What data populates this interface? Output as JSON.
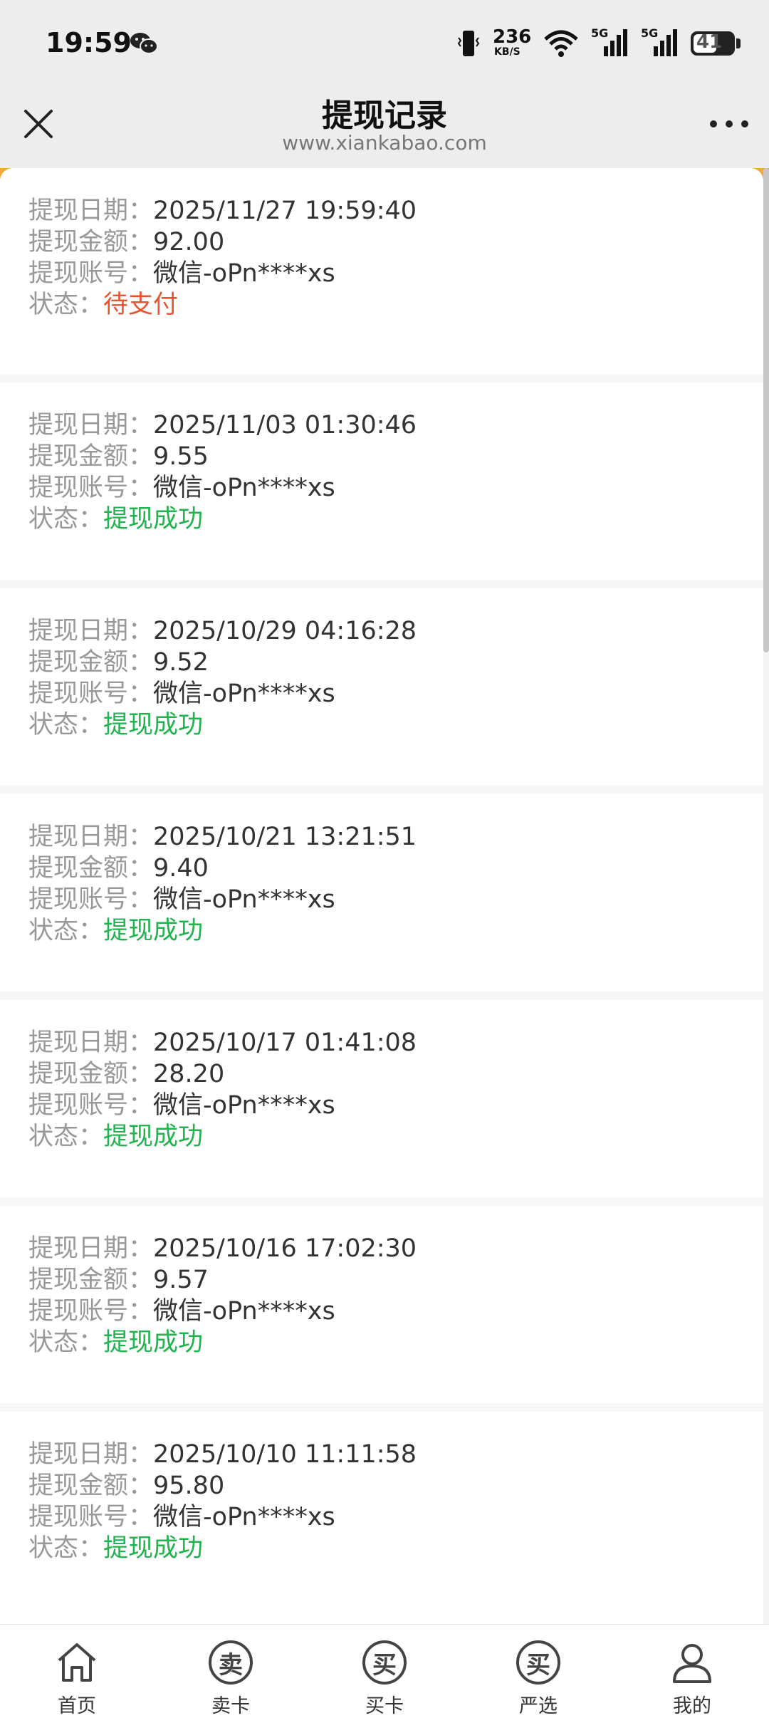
{
  "status_bar": {
    "time": "19:59",
    "network_speed": "236",
    "network_speed_unit": "KB/S",
    "signal1_label": "5G",
    "signal2_label": "5G",
    "battery": "41",
    "icons": [
      "wechat-icon",
      "vibrate-icon",
      "wifi-icon",
      "signal-icon",
      "battery-icon"
    ]
  },
  "header": {
    "title": "提现记录",
    "url": "www.xiankabao.com"
  },
  "labels": {
    "date": "提现日期：",
    "amount": "提现金额：",
    "account": "提现账号：",
    "status": "状态："
  },
  "records": [
    {
      "date": "2025/11/27 19:59:40",
      "amount": "92.00",
      "account": "微信-oPn****xs",
      "status": "待支付",
      "status_type": "pending"
    },
    {
      "date": "2025/11/03 01:30:46",
      "amount": "9.55",
      "account": "微信-oPn****xs",
      "status": "提现成功",
      "status_type": "success"
    },
    {
      "date": "2025/10/29 04:16:28",
      "amount": "9.52",
      "account": "微信-oPn****xs",
      "status": "提现成功",
      "status_type": "success"
    },
    {
      "date": "2025/10/21 13:21:51",
      "amount": "9.40",
      "account": "微信-oPn****xs",
      "status": "提现成功",
      "status_type": "success"
    },
    {
      "date": "2025/10/17 01:41:08",
      "amount": "28.20",
      "account": "微信-oPn****xs",
      "status": "提现成功",
      "status_type": "success"
    },
    {
      "date": "2025/10/16 17:02:30",
      "amount": "9.57",
      "account": "微信-oPn****xs",
      "status": "提现成功",
      "status_type": "success"
    },
    {
      "date": "2025/10/10 11:11:58",
      "amount": "95.80",
      "account": "微信-oPn****xs",
      "status": "提现成功",
      "status_type": "success"
    }
  ],
  "colors": {
    "pending": "#e8542e",
    "success": "#21b34e",
    "accent_orange": "#f4a83a"
  },
  "bottom_nav": [
    {
      "label": "首页",
      "icon": "home-icon"
    },
    {
      "label": "卖卡",
      "icon": "sell-card-icon",
      "glyph": "卖"
    },
    {
      "label": "买卡",
      "icon": "buy-card-icon",
      "glyph": "买"
    },
    {
      "label": "严选",
      "icon": "selected-icon",
      "glyph": "买"
    },
    {
      "label": "我的",
      "icon": "profile-icon"
    }
  ]
}
